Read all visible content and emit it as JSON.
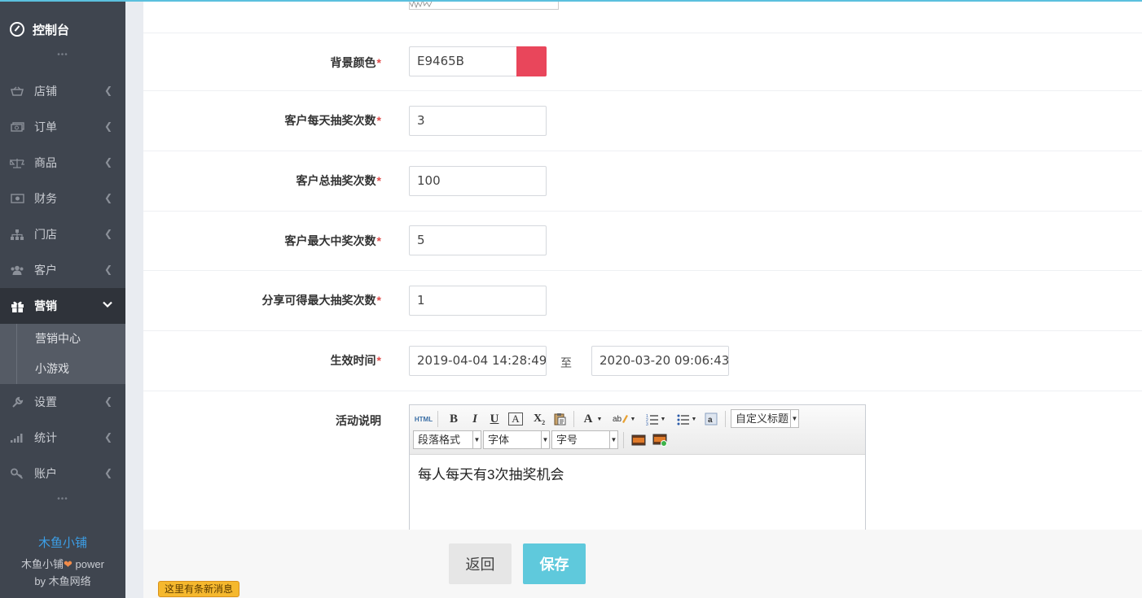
{
  "sidebar": {
    "dashboard": "控制台",
    "items": [
      {
        "label": "店铺",
        "icon": "basket-icon"
      },
      {
        "label": "订单",
        "icon": "money-icon"
      },
      {
        "label": "商品",
        "icon": "scale-icon"
      },
      {
        "label": "财务",
        "icon": "cash-icon"
      },
      {
        "label": "门店",
        "icon": "sitemap-icon"
      },
      {
        "label": "客户",
        "icon": "users-icon"
      },
      {
        "label": "营销",
        "icon": "gift-icon",
        "active": true
      },
      {
        "label": "设置",
        "icon": "wrench-icon"
      },
      {
        "label": "统计",
        "icon": "signal-icon"
      },
      {
        "label": "账户",
        "icon": "key-icon"
      }
    ],
    "submenu": [
      "营销中心",
      "小游戏"
    ],
    "footer": {
      "brand": "木鱼小铺",
      "powered_prefix": "木鱼小铺",
      "powered_suffix": " power",
      "by": "by 木鱼网络"
    }
  },
  "form": {
    "bg_color": {
      "label": "背景颜色",
      "value": "E9465B",
      "swatch": "#e9465b"
    },
    "daily_draws": {
      "label": "客户每天抽奖次数",
      "value": "3"
    },
    "total_draws": {
      "label": "客户总抽奖次数",
      "value": "100"
    },
    "max_wins": {
      "label": "客户最大中奖次数",
      "value": "5"
    },
    "share_draws": {
      "label": "分享可得最大抽奖次数",
      "value": "1"
    },
    "valid_time": {
      "label": "生效时间",
      "start": "2019-04-04 14:28:49",
      "separator": "至",
      "end": "2020-03-20 09:06:43"
    },
    "description": {
      "label": "活动说明",
      "content": "每人每天有3次抽奖机会"
    },
    "required_mark": "*"
  },
  "editor_toolbar": {
    "html": "HTML",
    "custom_title": "自定义标题",
    "paragraph": "段落格式",
    "font": "字体",
    "size": "字号"
  },
  "buttons": {
    "back": "返回",
    "save": "保存"
  },
  "notice": "这里有条新消息",
  "colors": {
    "sidebar_bg": "#3f454f",
    "accent": "#5fc9dc",
    "required": "#e14b4b"
  }
}
